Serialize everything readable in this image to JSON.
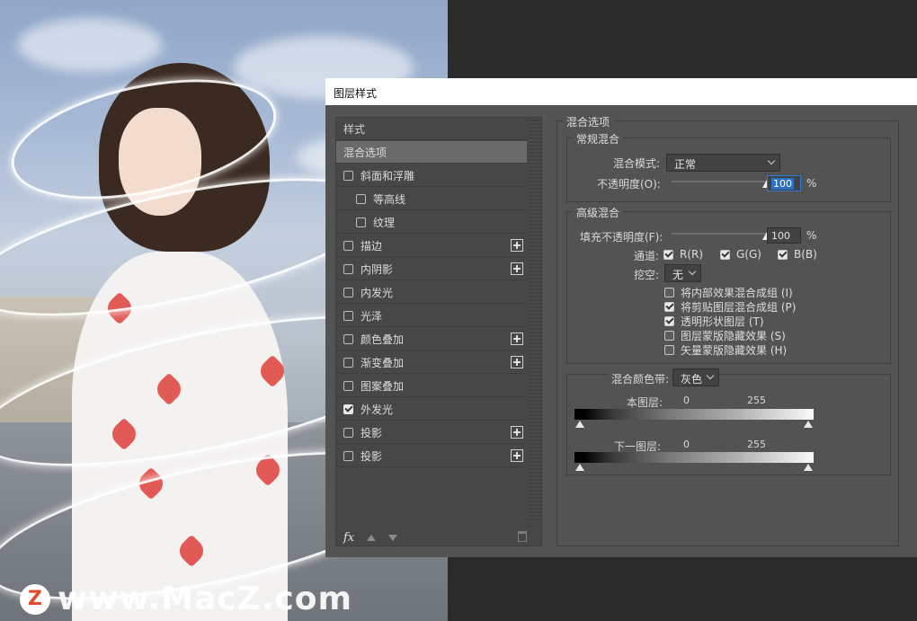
{
  "dialog": {
    "title": "图层样式"
  },
  "styles_panel": {
    "header": "样式",
    "items": [
      {
        "label": "混合选项",
        "checkbox": false,
        "checked": false,
        "plus": false,
        "active": true,
        "indent": 0
      },
      {
        "label": "斜面和浮雕",
        "checkbox": true,
        "checked": false,
        "plus": false,
        "active": false,
        "indent": 0
      },
      {
        "label": "等高线",
        "checkbox": true,
        "checked": false,
        "plus": false,
        "active": false,
        "indent": 1
      },
      {
        "label": "纹理",
        "checkbox": true,
        "checked": false,
        "plus": false,
        "active": false,
        "indent": 1
      },
      {
        "label": "描边",
        "checkbox": true,
        "checked": false,
        "plus": true,
        "active": false,
        "indent": 0
      },
      {
        "label": "内阴影",
        "checkbox": true,
        "checked": false,
        "plus": true,
        "active": false,
        "indent": 0
      },
      {
        "label": "内发光",
        "checkbox": true,
        "checked": false,
        "plus": false,
        "active": false,
        "indent": 0
      },
      {
        "label": "光泽",
        "checkbox": true,
        "checked": false,
        "plus": false,
        "active": false,
        "indent": 0
      },
      {
        "label": "颜色叠加",
        "checkbox": true,
        "checked": false,
        "plus": true,
        "active": false,
        "indent": 0
      },
      {
        "label": "渐变叠加",
        "checkbox": true,
        "checked": false,
        "plus": true,
        "active": false,
        "indent": 0
      },
      {
        "label": "图案叠加",
        "checkbox": true,
        "checked": false,
        "plus": false,
        "active": false,
        "indent": 0
      },
      {
        "label": "外发光",
        "checkbox": true,
        "checked": true,
        "plus": false,
        "active": false,
        "indent": 0
      },
      {
        "label": "投影",
        "checkbox": true,
        "checked": false,
        "plus": true,
        "active": false,
        "indent": 0
      },
      {
        "label": "投影",
        "checkbox": true,
        "checked": false,
        "plus": true,
        "active": false,
        "indent": 0
      }
    ],
    "footer": {
      "fx_label": "fx"
    }
  },
  "blend_options": {
    "section_title": "混合选项",
    "general": {
      "title": "常规混合",
      "blend_mode_label": "混合模式:",
      "blend_mode_value": "正常",
      "opacity_label": "不透明度(O):",
      "opacity_value": "100",
      "opacity_unit": "%",
      "opacity_level": 1.0
    },
    "advanced": {
      "title": "高级混合",
      "fill_opacity_label": "填充不透明度(F):",
      "fill_opacity_value": "100",
      "fill_opacity_unit": "%",
      "fill_opacity_level": 1.0,
      "channels_label": "通道:",
      "channels": [
        {
          "label": "R(R)",
          "checked": true
        },
        {
          "label": "G(G)",
          "checked": true
        },
        {
          "label": "B(B)",
          "checked": true
        }
      ],
      "knockout_label": "挖空:",
      "knockout_value": "无",
      "options": [
        {
          "label": "将内部效果混合成组 (I)",
          "checked": false
        },
        {
          "label": "将剪贴图层混合成组 (P)",
          "checked": true
        },
        {
          "label": "透明形状图层 (T)",
          "checked": true
        },
        {
          "label": "图层蒙版隐藏效果 (S)",
          "checked": false
        },
        {
          "label": "矢量蒙版隐藏效果 (H)",
          "checked": false
        }
      ]
    },
    "blend_if": {
      "label": "混合颜色带:",
      "value": "灰色",
      "this_layer_label": "本图层:",
      "this_layer_min": "0",
      "this_layer_max": "255",
      "underlying_label": "下一图层:",
      "underlying_min": "0",
      "underlying_max": "255"
    }
  },
  "watermark": {
    "logo_letter": "Z",
    "text": "www.MacZ.com"
  }
}
